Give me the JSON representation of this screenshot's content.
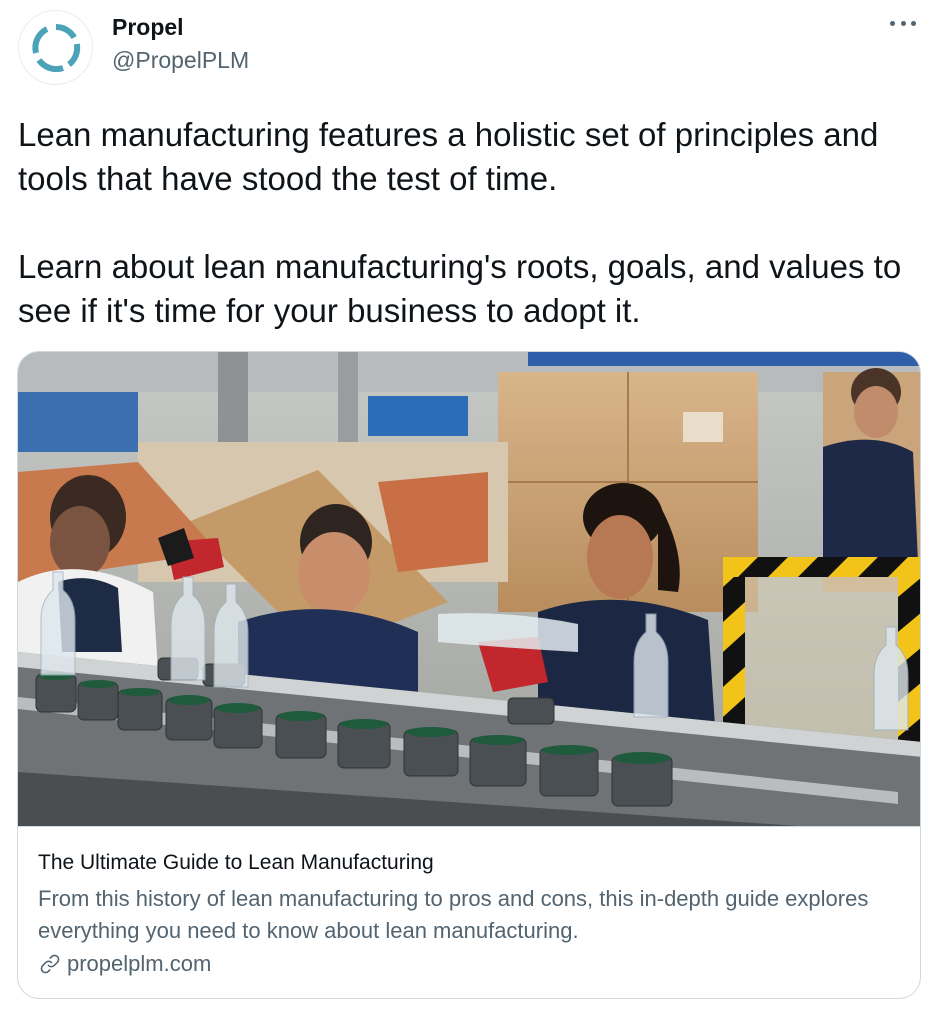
{
  "author": {
    "name": "Propel",
    "handle": "@PropelPLM",
    "avatar_icon": "propel-logo-icon",
    "brand_color": "#4aa3b8"
  },
  "menu": {
    "more_icon": "more-dots-icon"
  },
  "tweet": {
    "paragraphs": [
      "Lean manufacturing features a holistic set of principles and tools that have stood the test of time.",
      "Learn about lean manufacturing's roots, goals, and values to see if it's time for your business to adopt it."
    ]
  },
  "card": {
    "image_icon": "factory-bottling-line-photo",
    "title": "The Ultimate Guide to Lean Manufacturing",
    "description": "From this history of lean manufacturing to pros and cons, this in-depth guide explores everything you need to know about lean manufacturing.",
    "domain": "propelplm.com",
    "link_icon": "link-icon"
  },
  "colors": {
    "text_primary": "#0f1419",
    "text_secondary": "#536471",
    "border": "#cfd9de",
    "hazard_yellow": "#f2c318"
  }
}
